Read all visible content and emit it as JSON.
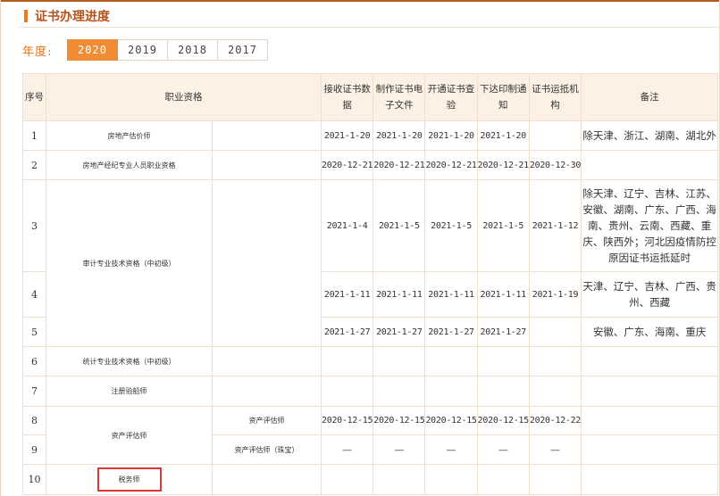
{
  "section_title": "证书办理进度",
  "year_label": "年度:",
  "years": [
    "2020",
    "2019",
    "2018",
    "2017"
  ],
  "active_year": "2020",
  "table": {
    "headers": {
      "seq": "序号",
      "qualification": "职业资格",
      "receive": "接收证书数据",
      "make": "制作证书电子文件",
      "check": "开通证书查验",
      "notice": "下达印制通知",
      "ship": "证书运抵机构",
      "remark": "备注"
    },
    "rows": [
      {
        "no": "1",
        "name": "房地产估价师",
        "sub": "",
        "d1": "2021-1-20",
        "d2": "2021-1-20",
        "d3": "2021-1-20",
        "d4": "2021-1-20",
        "d5": "",
        "remark": "除天津、浙江、湖南、湖北外"
      },
      {
        "no": "2",
        "name": "房地产经纪专业人员职业资格",
        "sub": "",
        "d1": "2020-12-21",
        "d2": "2020-12-21",
        "d3": "2020-12-21",
        "d4": "2020-12-21",
        "d5": "2020-12-30",
        "remark": ""
      },
      {
        "no": "3",
        "name": "审计专业技术资格（中初级）",
        "sub": "",
        "d1": "2021-1-4",
        "d2": "2021-1-5",
        "d3": "2021-1-5",
        "d4": "2021-1-5",
        "d5": "2021-1-12",
        "remark": "除天津、辽宁、吉林、江苏、安徽、湖南、广东、广西、海南、贵州、云南、西藏、重庆、陕西外；河北因疫情防控原因证书运抵延时"
      },
      {
        "no": "4",
        "name": "",
        "sub": "",
        "d1": "2021-1-11",
        "d2": "2021-1-11",
        "d3": "2021-1-11",
        "d4": "2021-1-11",
        "d5": "2021-1-19",
        "remark": "天津、辽宁、吉林、广西、贵州、西藏"
      },
      {
        "no": "5",
        "name": "",
        "sub": "",
        "d1": "2021-1-27",
        "d2": "2021-1-27",
        "d3": "2021-1-27",
        "d4": "2021-1-27",
        "d5": "",
        "remark": "安徽、广东、海南、重庆"
      },
      {
        "no": "6",
        "name": "统计专业技术资格（中初级）",
        "sub": "",
        "d1": "",
        "d2": "",
        "d3": "",
        "d4": "",
        "d5": "",
        "remark": ""
      },
      {
        "no": "7",
        "name": "注册验船师",
        "sub": "",
        "d1": "",
        "d2": "",
        "d3": "",
        "d4": "",
        "d5": "",
        "remark": ""
      },
      {
        "no": "8",
        "name": "资产评估师",
        "sub": "资产评估师",
        "d1": "2020-12-15",
        "d2": "2020-12-15",
        "d3": "2020-12-15",
        "d4": "2020-12-15",
        "d5": "2020-12-22",
        "remark": ""
      },
      {
        "no": "9",
        "name": "",
        "sub": "资产评估师（珠宝）",
        "d1": "—",
        "d2": "—",
        "d3": "—",
        "d4": "—",
        "d5": "—",
        "remark": ""
      },
      {
        "no": "10",
        "name": "税务师",
        "sub": "",
        "d1": "",
        "d2": "",
        "d3": "",
        "d4": "",
        "d5": "",
        "remark": ""
      }
    ]
  }
}
